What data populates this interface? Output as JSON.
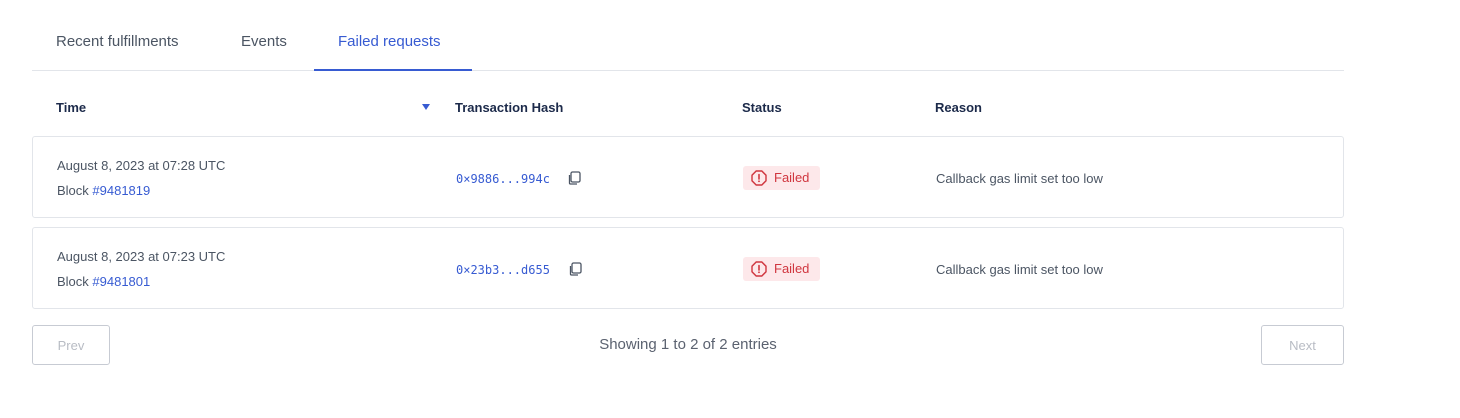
{
  "tabs": [
    {
      "label": "Recent fulfillments",
      "active": false
    },
    {
      "label": "Events",
      "active": false
    },
    {
      "label": "Failed requests",
      "active": true
    }
  ],
  "table": {
    "columns": {
      "time": "Time",
      "hash": "Transaction Hash",
      "status": "Status",
      "reason": "Reason"
    },
    "sort_icon": "sort-desc-icon",
    "rows": [
      {
        "date": "August 8, 2023 at 07:28 UTC",
        "block_prefix": "Block ",
        "block": "#9481819",
        "hash": "0×9886...994c",
        "status": "Failed",
        "reason": "Callback gas limit set too low"
      },
      {
        "date": "August 8, 2023 at 07:23 UTC",
        "block_prefix": "Block ",
        "block": "#9481801",
        "hash": "0×23b3...d655",
        "status": "Failed",
        "reason": "Callback gas limit set too low"
      }
    ]
  },
  "pagination": {
    "prev_label": "Prev",
    "next_label": "Next",
    "summary": "Showing 1 to 2 of 2 entries"
  },
  "colors": {
    "accent": "#375bd2",
    "failed_text": "#d0363f",
    "failed_bg": "#fde8ea"
  }
}
